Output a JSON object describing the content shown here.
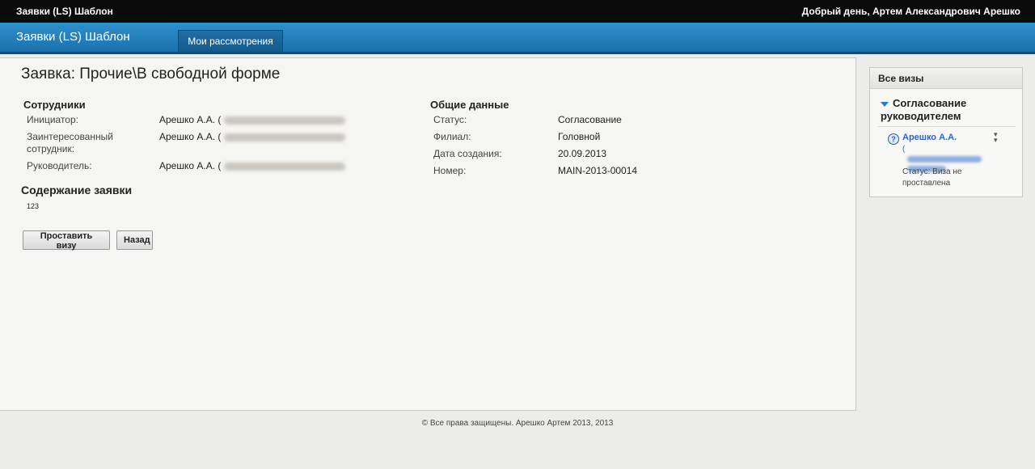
{
  "topbar": {
    "app_name": "Заявки (LS) Шаблон",
    "greeting": "Добрый день, Артем Александрович Арешко"
  },
  "navbar": {
    "title": "Заявки (LS) Шаблон",
    "tabs": [
      {
        "label": "Мои рассмотрения"
      }
    ]
  },
  "page": {
    "title": "Заявка: Прочие\\В свободной форме"
  },
  "employees": {
    "heading": "Сотрудники",
    "rows": [
      {
        "label": "Инициатор:",
        "value": "Арешко А.А. ("
      },
      {
        "label": "Заинтересованный сотрудник:",
        "value": "Арешко А.А. ("
      },
      {
        "label": "Руководитель:",
        "value": "Арешко А.А. ("
      }
    ]
  },
  "general": {
    "heading": "Общие данные",
    "rows": [
      {
        "label": "Статус:",
        "value": "Согласование"
      },
      {
        "label": "Филиал:",
        "value": "Головной"
      },
      {
        "label": "Дата создания:",
        "value": "20.09.2013"
      },
      {
        "label": "Номер:",
        "value": "MAIN-2013-00014"
      }
    ]
  },
  "content": {
    "heading": "Содержание заявки",
    "value": "123"
  },
  "buttons": {
    "visa": "Проставить визу",
    "back": "Назад"
  },
  "visas": {
    "header": "Все визы",
    "group_title": "Согласование руководителем",
    "entry": {
      "name": "Арешко А.А.",
      "role_prefix": "(",
      "status": "Статус: Виза не проставлена"
    },
    "icons": {
      "status": "question-icon",
      "expand": "double-chevron-down-icon"
    }
  },
  "footer": {
    "text": "© Все права защищены. Арешко Артем 2013, 2013"
  }
}
